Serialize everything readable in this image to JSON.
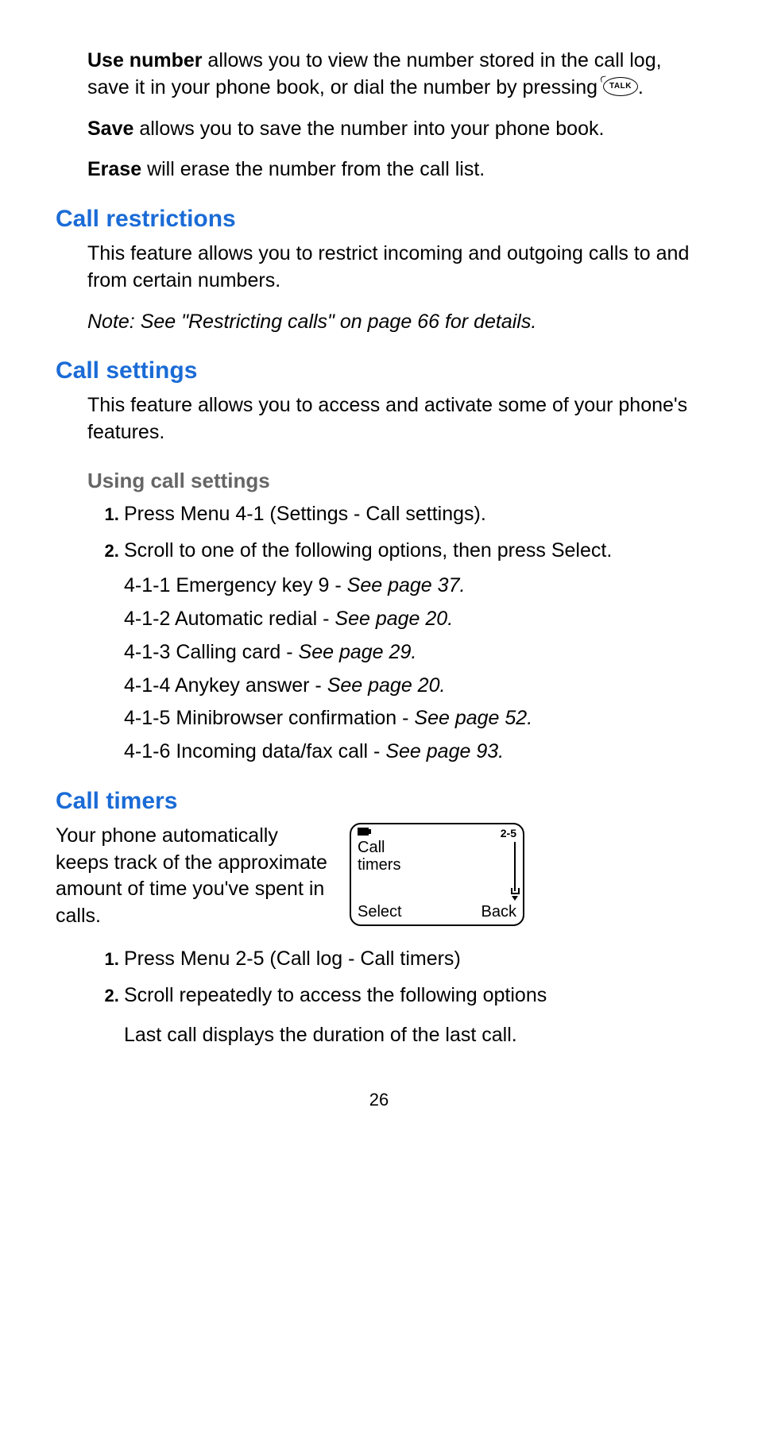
{
  "intro": {
    "use_number_bold": "Use number",
    "use_number_text": " allows you to view the number stored in the call log, save it in your phone book, or dial the number by pressing ",
    "use_number_suffix": ".",
    "talk_label": "TALK",
    "save_bold": "Save",
    "save_text": " allows you to save the number into your phone book.",
    "erase_bold": "Erase",
    "erase_text": " will erase the number from the call list."
  },
  "restrictions": {
    "heading": "Call restrictions",
    "body": "This feature allows you to restrict incoming and outgoing calls to and from certain numbers.",
    "note_label": "Note: ",
    "note_text": "See \"Restricting calls\" on page 66 for details."
  },
  "settings": {
    "heading": "Call settings",
    "body": "This feature allows you to access and activate some of your phone's features.",
    "sub_heading": "Using call settings",
    "step1_a": "Press ",
    "step1_b": "Menu",
    "step1_c": " 4-1 (",
    "step1_d": "Settings",
    "step1_e": " - ",
    "step1_f": "Call settings",
    "step1_g": ").",
    "step2_a": "Scroll to one of the following options, then press ",
    "step2_b": "Select",
    "step2_c": ".",
    "refs": [
      {
        "code": "4-1-1 ",
        "name": "Emergency key 9",
        "sep": " - ",
        "page": "See page 37."
      },
      {
        "code": "4-1-2 ",
        "name": "Automatic redial",
        "sep": " - ",
        "page": "See page 20."
      },
      {
        "code": "4-1-3 ",
        "name": "Calling card",
        "sep": " - ",
        "page": "See page 29."
      },
      {
        "code": "4-1-4 ",
        "name": "Anykey answer",
        "sep": " - ",
        "page": "See page 20."
      },
      {
        "code": "4-1-5 ",
        "name": "Minibrowser confirmation",
        "sep": " - ",
        "page": "See page 52."
      },
      {
        "code": "4-1-6 ",
        "name": "Incoming data/fax call",
        "sep": " - ",
        "page": "See page 93."
      }
    ]
  },
  "timers": {
    "heading": "Call timers",
    "intro": "Your phone automatically keeps track of the approximate amount of time you've spent in calls.",
    "step1_a": "Press ",
    "step1_b": "Menu",
    "step1_c": " 2-5 (",
    "step1_d": "Call log",
    "step1_e": " - ",
    "step1_f": "Call timers",
    "step1_g": ")",
    "step2": "Scroll repeatedly to access the following options",
    "last_call_bold": "Last call",
    "last_call_text": " displays the duration of the last call.",
    "screen": {
      "menu_num": "2-5",
      "line1": "Call",
      "line2": "timers",
      "left_soft": "Select",
      "right_soft": "Back"
    }
  },
  "page_num": "26"
}
